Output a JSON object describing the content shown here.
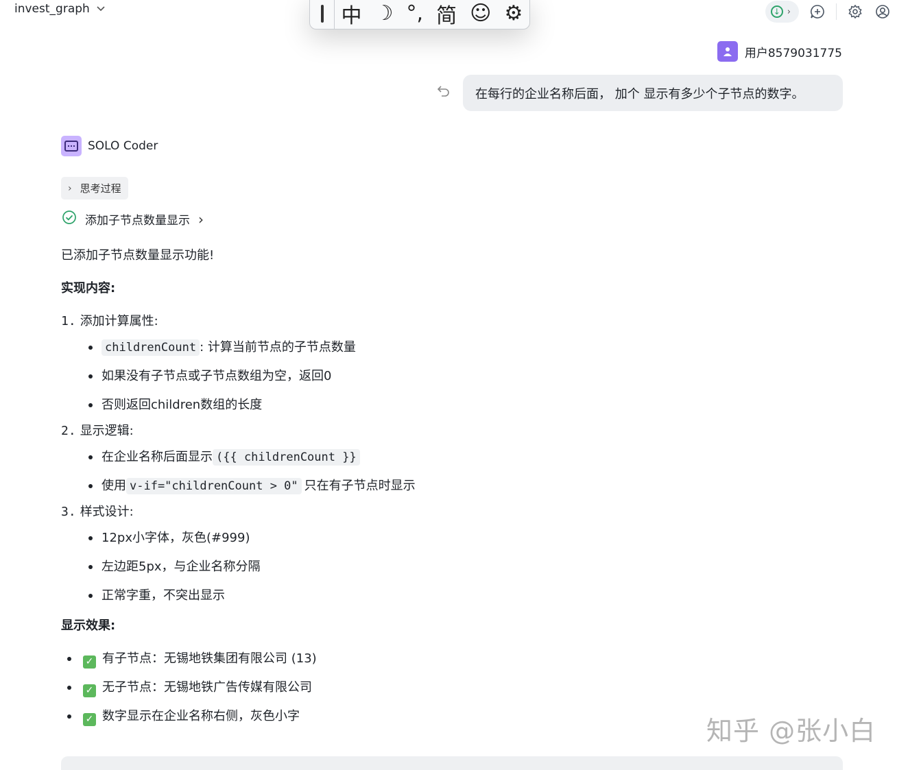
{
  "header": {
    "project_name": "invest_graph"
  },
  "ime_toolbar": {
    "items": [
      "中",
      "☽",
      "°,",
      "简",
      "☺",
      "⚙"
    ]
  },
  "user": {
    "name": "用户8579031775",
    "message": "在每行的企业名称后面， 加个 显示有多少个子节点的数字。"
  },
  "agent": {
    "name": "SOLO Coder",
    "thinking_label": "思考过程",
    "task_label": "添加子节点数量显示"
  },
  "reply": {
    "intro": "已添加子节点数量显示功能!",
    "impl_heading": "实现内容:",
    "sections": [
      {
        "num": "1.",
        "title": "添加计算属性:",
        "items": [
          {
            "code": "childrenCount",
            "text": ": 计算当前节点的子节点数量"
          },
          {
            "text": "如果没有子节点或子节点数组为空，返回0"
          },
          {
            "text": "否则返回children数组的长度"
          }
        ]
      },
      {
        "num": "2.",
        "title": "显示逻辑:",
        "items": [
          {
            "pre": "在企业名称后面显示",
            "code": "({{ childrenCount }}"
          },
          {
            "pre": "使用",
            "code": "v-if=\"childrenCount > 0\"",
            "text": "只在有子节点时显示"
          }
        ]
      },
      {
        "num": "3.",
        "title": "样式设计:",
        "items": [
          {
            "text": "12px小字体，灰色(#999)"
          },
          {
            "text": "左边距5px，与企业名称分隔"
          },
          {
            "text": "正常字重，不突出显示"
          }
        ]
      }
    ],
    "effect_heading": "显示效果:",
    "effects": [
      "有子节点：无锡地铁集团有限公司 (13)",
      "无子节点：无锡地铁广告传媒有限公司",
      "数字显示在企业名称右侧，灰色小字"
    ]
  },
  "watermark": "知乎 @张小白",
  "colors": {
    "user_avatar": "#8b6cf0",
    "agent_avatar": "#c9b3ff",
    "check_green": "#5cb85c",
    "success_green": "#2ea36a"
  }
}
